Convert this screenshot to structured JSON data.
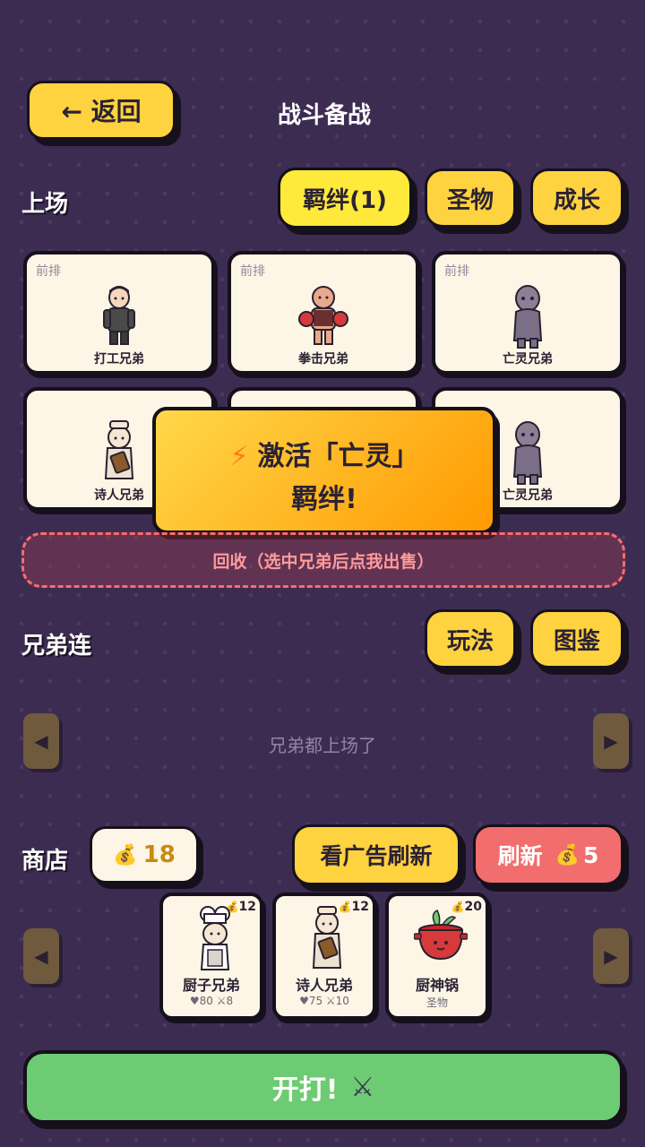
{
  "header": {
    "back_label": "← 返回",
    "title": "战斗备战"
  },
  "lineup": {
    "title": "上场",
    "tabs": [
      {
        "label": "羁绊(1)",
        "active": true
      },
      {
        "label": "圣物",
        "active": false
      },
      {
        "label": "成长",
        "active": false
      }
    ],
    "slots": [
      {
        "position": "前排",
        "name": "打工兄弟",
        "icon": "worker-character-icon"
      },
      {
        "position": "前排",
        "name": "拳击兄弟",
        "icon": "boxer-character-icon"
      },
      {
        "position": "前排",
        "name": "亡灵兄弟",
        "icon": "undead-character-icon"
      },
      {
        "position": "",
        "name": "诗人兄弟",
        "icon": "poet-character-icon"
      },
      {
        "position": "",
        "name": "",
        "icon": ""
      },
      {
        "position": "",
        "name": "亡灵兄弟",
        "icon": "undead-character-icon"
      }
    ],
    "sell_zone": "回收（选中兄弟后点我出售）"
  },
  "popup": {
    "line1": "激活「亡灵」",
    "line2": "羁绊!",
    "icon": "lightning-icon"
  },
  "bench": {
    "title": "兄弟连",
    "buttons": [
      "玩法",
      "图鉴"
    ],
    "empty_text": "兄弟都上场了"
  },
  "shop": {
    "title": "商店",
    "gold": "18",
    "ad_refresh_label": "看广告刷新",
    "refresh_label": "刷新",
    "refresh_cost": "5",
    "items": [
      {
        "name": "厨子兄弟",
        "price": "12",
        "stats": "♥80 ⚔8",
        "icon": "chef-character-icon"
      },
      {
        "name": "诗人兄弟",
        "price": "12",
        "stats": "♥75 ⚔10",
        "icon": "poet-character-icon"
      },
      {
        "name": "厨神锅",
        "price": "20",
        "stats": "圣物",
        "icon": "cooking-pot-icon"
      }
    ]
  },
  "fight_label": "开打!",
  "colors": {
    "background": "#3d2c52",
    "yellow": "#ffd23f",
    "red": "#f26d6d",
    "green": "#6dcb73",
    "card": "#fdf6e6"
  }
}
